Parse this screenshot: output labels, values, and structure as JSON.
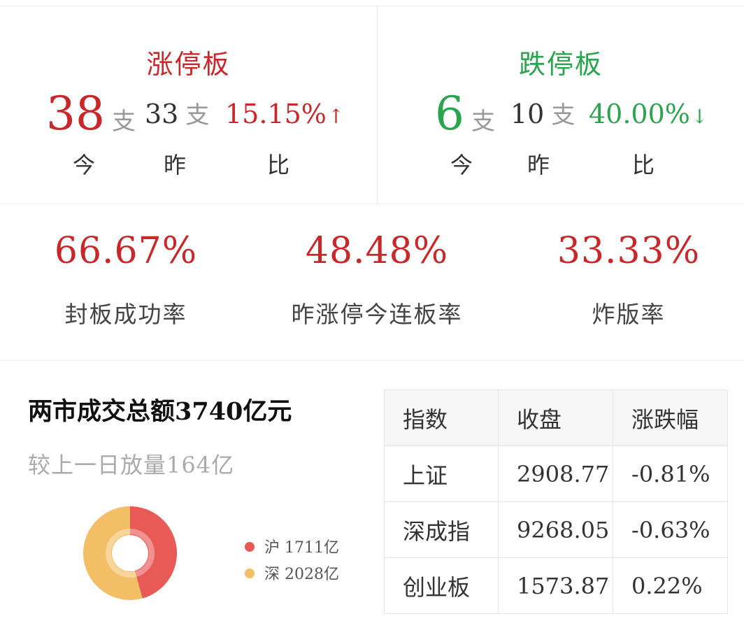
{
  "limit_up": {
    "title": "涨停板",
    "today_count": "38",
    "unit": "支",
    "yesterday_count": "33",
    "change_pct": "15.15%",
    "change_arrow": "↑",
    "label_today": "今",
    "label_yesterday": "昨",
    "label_ratio": "比"
  },
  "limit_down": {
    "title": "跌停板",
    "today_count": "6",
    "unit": "支",
    "yesterday_count": "10",
    "change_pct": "40.00%",
    "change_arrow": "↓",
    "label_today": "今",
    "label_yesterday": "昨",
    "label_ratio": "比"
  },
  "rates": [
    {
      "value": "66.67%",
      "label": "封板成功率"
    },
    {
      "value": "48.48%",
      "label": "昨涨停今连板率"
    },
    {
      "value": "33.33%",
      "label": "炸版率"
    }
  ],
  "turnover": {
    "title": "两市成交总额3740亿元",
    "subtitle": "较上一日放量164亿",
    "legend": [
      {
        "name": "沪",
        "value": "1711亿",
        "color": "#e85a55"
      },
      {
        "name": "深",
        "value": "2028亿",
        "color": "#f3bf66"
      }
    ]
  },
  "chart_data": {
    "type": "pie",
    "categories": [
      "沪",
      "深"
    ],
    "values": [
      1711,
      2028
    ],
    "colors": [
      "#e85a55",
      "#f3bf66"
    ]
  },
  "index_table": {
    "headers": [
      "指数",
      "收盘",
      "涨跌幅"
    ],
    "rows": [
      {
        "name": "上证",
        "close": "2908.77",
        "change": "-0.81%",
        "close_color": "green",
        "change_color": "green"
      },
      {
        "name": "深成指",
        "close": "9268.05",
        "change": "-0.63%",
        "close_color": "green",
        "change_color": "green"
      },
      {
        "name": "创业板",
        "close": "1573.87",
        "change": "0.22%",
        "close_color": "red",
        "change_color": "red"
      }
    ]
  }
}
